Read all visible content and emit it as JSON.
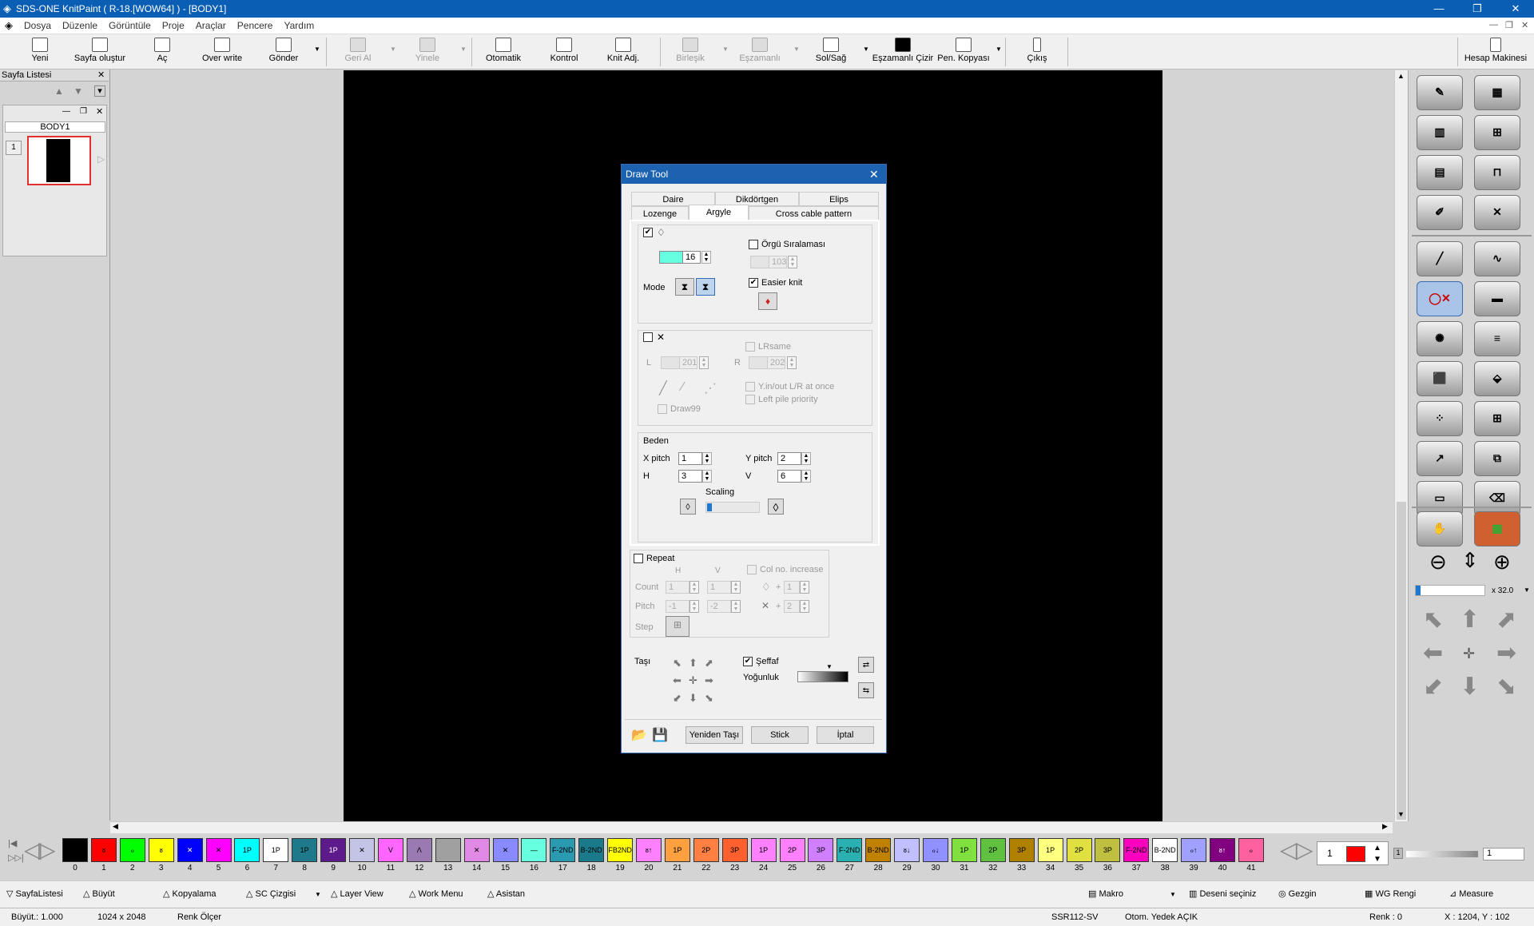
{
  "window": {
    "title": "SDS-ONE KnitPaint ( R-18.[WOW64] ) - [BODY1]"
  },
  "menu": [
    "Dosya",
    "Düzenle",
    "Görüntüle",
    "Proje",
    "Araçlar",
    "Pencere",
    "Yardım"
  ],
  "toolbar": [
    "Yeni",
    "Sayfa oluştur",
    "Aç",
    "Over write",
    "Gönder",
    "Geri Al",
    "Yinele",
    "Otomatik",
    "Kontrol",
    "Knit Adj.",
    "Birleşik",
    "Eşzamanlı",
    "Sol/Sağ",
    "Eşzamanlı Çizir",
    "Pen. Kopyası",
    "Çıkış",
    "Hesap Makinesi"
  ],
  "pagelist": {
    "title": "Sayfa Listesi",
    "body": "BODY1",
    "page_num": "1"
  },
  "dialog": {
    "title": "Draw Tool",
    "tabs": {
      "daire": "Daire",
      "dikdortgen": "Dikdörtgen",
      "elips": "Elips",
      "lozenge": "Lozenge",
      "argyle": "Argyle",
      "cross": "Cross cable pattern"
    },
    "color_value": "16",
    "orgu": "Örgü Sıralaması",
    "orgu_value": "103",
    "mode": "Mode",
    "easier": "Easier knit",
    "lrsame": "LRsame",
    "l": "L",
    "l_value": "201",
    "r": "R",
    "r_value": "202",
    "yinout": "Y.in/out L/R at once",
    "leftpile": "Left pile priority",
    "draw99": "Draw99",
    "beden": "Beden",
    "xpitch": "X pitch",
    "xpitch_value": "1",
    "ypitch": "Y pitch",
    "ypitch_value": "2",
    "h": "H",
    "h_value": "3",
    "v": "V",
    "v_value": "6",
    "scaling": "Scaling",
    "repeat": "Repeat",
    "rh": "H",
    "rv": "V",
    "colno": "Col no. increase",
    "count": "Count",
    "count_h": "1",
    "count_v": "1",
    "inc1": "1",
    "pitch": "Pitch",
    "pitch_h": "-1",
    "pitch_v": "-2",
    "inc2": "2",
    "step": "Step",
    "tasi": "Taşı",
    "seffaf": "Şeffaf",
    "yogunluk": "Yoğunluk",
    "btn_yeniden": "Yeniden Taşı",
    "btn_stick": "Stick",
    "btn_iptal": "İptal"
  },
  "palette": [
    {
      "n": "0",
      "c": "#000000",
      "t": ""
    },
    {
      "n": "1",
      "c": "#ff0000",
      "t": "ᴕ"
    },
    {
      "n": "2",
      "c": "#00ff00",
      "t": "ℴ"
    },
    {
      "n": "3",
      "c": "#ffff00",
      "t": "ᴕ"
    },
    {
      "n": "4",
      "c": "#0000ff",
      "t": "✕"
    },
    {
      "n": "5",
      "c": "#ff00ff",
      "t": "✕"
    },
    {
      "n": "6",
      "c": "#00ffff",
      "t": "1P"
    },
    {
      "n": "7",
      "c": "#ffffff",
      "t": "1P"
    },
    {
      "n": "8",
      "c": "#1e7a8a",
      "t": "1P"
    },
    {
      "n": "9",
      "c": "#5c1a8a",
      "t": "1P"
    },
    {
      "n": "10",
      "c": "#c4c4e6",
      "t": "✕"
    },
    {
      "n": "11",
      "c": "#ff66ff",
      "t": "V"
    },
    {
      "n": "12",
      "c": "#9a7ab0",
      "t": "Λ"
    },
    {
      "n": "13",
      "c": "#a0a0a0",
      "t": ""
    },
    {
      "n": "14",
      "c": "#e08ae6",
      "t": "✕"
    },
    {
      "n": "15",
      "c": "#8a8aff",
      "t": "✕"
    },
    {
      "n": "16",
      "c": "#66ffe0",
      "t": "—"
    },
    {
      "n": "17",
      "c": "#2a9ab0",
      "t": "F-2ND"
    },
    {
      "n": "18",
      "c": "#1a7a8a",
      "t": "B-2ND"
    },
    {
      "n": "19",
      "c": "#ffff00",
      "t": "FB2ND"
    },
    {
      "n": "20",
      "c": "#ff80ff",
      "t": "ᴕ↑"
    },
    {
      "n": "21",
      "c": "#ffa040",
      "t": "1P"
    },
    {
      "n": "22",
      "c": "#ff8040",
      "t": "2P"
    },
    {
      "n": "23",
      "c": "#ff6030",
      "t": "3P"
    },
    {
      "n": "24",
      "c": "#ff80ff",
      "t": "1P"
    },
    {
      "n": "25",
      "c": "#ff80ff",
      "t": "2P"
    },
    {
      "n": "26",
      "c": "#d080ff",
      "t": "3P"
    },
    {
      "n": "27",
      "c": "#2ab0b0",
      "t": "F-2ND"
    },
    {
      "n": "28",
      "c": "#c08000",
      "t": "B-2ND"
    },
    {
      "n": "29",
      "c": "#c0c0ff",
      "t": "ᴕ↓"
    },
    {
      "n": "30",
      "c": "#9090ff",
      "t": "ℴ↓"
    },
    {
      "n": "31",
      "c": "#80e040",
      "t": "1P"
    },
    {
      "n": "32",
      "c": "#60c040",
      "t": "2P"
    },
    {
      "n": "33",
      "c": "#b08000",
      "t": "3P"
    },
    {
      "n": "34",
      "c": "#ffff80",
      "t": "1P"
    },
    {
      "n": "35",
      "c": "#e0e040",
      "t": "2P"
    },
    {
      "n": "36",
      "c": "#c0c040",
      "t": "3P"
    },
    {
      "n": "37",
      "c": "#ff00c0",
      "t": "F-2ND"
    },
    {
      "n": "38",
      "c": "#ffffff",
      "t": "B-2ND"
    },
    {
      "n": "39",
      "c": "#a0a0ff",
      "t": "ℴ↑"
    },
    {
      "n": "40",
      "c": "#800080",
      "t": "ᴕ↑"
    },
    {
      "n": "41",
      "c": "#ff60a0",
      "t": "ℴ"
    }
  ],
  "palette_right": {
    "value": "1",
    "value2": "1"
  },
  "bottombar": [
    "SayfaListesi",
    "Büyüt",
    "Kopyalama",
    "SC Çizgisi",
    "Layer View",
    "Work Menu",
    "Asistan",
    "Makro",
    "Deseni seçiniz",
    "Gezgin",
    "WG Rengi",
    "Measure"
  ],
  "status": {
    "zoom": "Büyüt.: 1.000",
    "size": "1024 x 2048",
    "renk_olcer": "Renk Ölçer",
    "machine": "SSR112-SV",
    "backup": "Otom. Yedek AÇIK",
    "renk": "Renk : 0",
    "coords": "X : 1204, Y : 102"
  },
  "zoom": "x 32.0"
}
